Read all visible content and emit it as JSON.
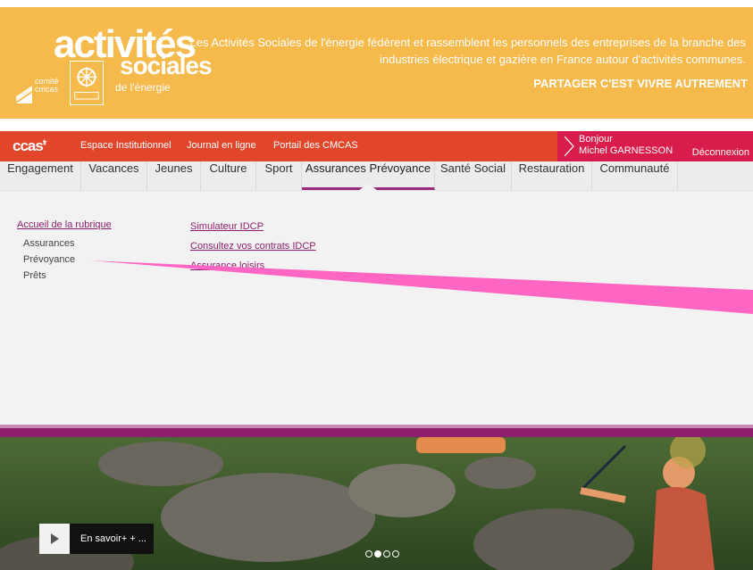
{
  "banner": {
    "logo_line1": "activités",
    "logo_line2": "sociales",
    "logo_line3": "de l'énergie",
    "logo_comite": "comité",
    "logo_cmcas": "cmcas",
    "intro": "Les Activités Sociales de l'énergie fédèrent et rassemblent les personnels des entreprises de la branche des industries électrique et gazière en France autour d'activités communes.",
    "slogan": "PARTAGER C'EST VIVRE AUTREMENT"
  },
  "topbar": {
    "brand": "ccas",
    "brand_sup": "fr",
    "links": [
      "Espace Institutionnel",
      "Journal en ligne",
      "Portail des CMCAS"
    ],
    "greeting": "Bonjour",
    "user_name": "Michel GARNESSON",
    "logout": "Déconnexion"
  },
  "nav": {
    "items": [
      "Engagement",
      "Vacances",
      "Jeunes",
      "Culture",
      "Sport",
      "Assurances Prévoyance",
      "Santé Social",
      "Restauration",
      "Communauté"
    ],
    "active_index": 5
  },
  "dropdown": {
    "section_title": "Accueil de la rubrique",
    "sub_items": [
      "Assurances",
      "Prévoyance",
      "Prêts"
    ],
    "links": [
      "Simulateur IDCP",
      "Consultez vos contrats IDCP",
      "Assurance loisirs"
    ]
  },
  "hero": {
    "cta_label": "En savoir+ + ...",
    "slides_total": 4,
    "slide_active": 2
  },
  "colors": {
    "banner": "#f6b94b",
    "topbar": "#e1452a",
    "user_zone": "#d81c4b",
    "accent": "#8e1f6e",
    "highlight_pointer": "#ff66c4"
  }
}
